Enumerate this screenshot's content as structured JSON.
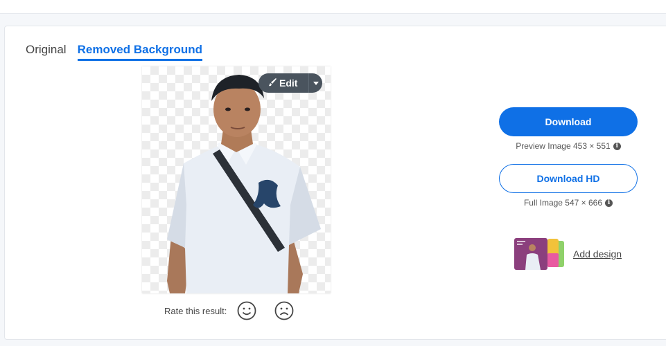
{
  "tabs": [
    {
      "label": "Original",
      "active": false
    },
    {
      "label": "Removed Background",
      "active": true
    }
  ],
  "preview": {
    "edit_label": "Edit",
    "edit_icon": "brush-icon",
    "dropdown_icon": "caret-down-icon"
  },
  "rating": {
    "label": "Rate this result:",
    "positive_icon": "smile-icon",
    "negative_icon": "frown-icon"
  },
  "downloads": {
    "download_label": "Download",
    "preview_info": "Preview Image 453 × 551",
    "download_hd_label": "Download HD",
    "full_info": "Full Image 547 × 666",
    "info_icon": "info-icon"
  },
  "add_design": {
    "label": "Add design"
  },
  "colors": {
    "accent": "#0f70e6",
    "edit_pill": "#4a545e",
    "text": "#454545"
  }
}
